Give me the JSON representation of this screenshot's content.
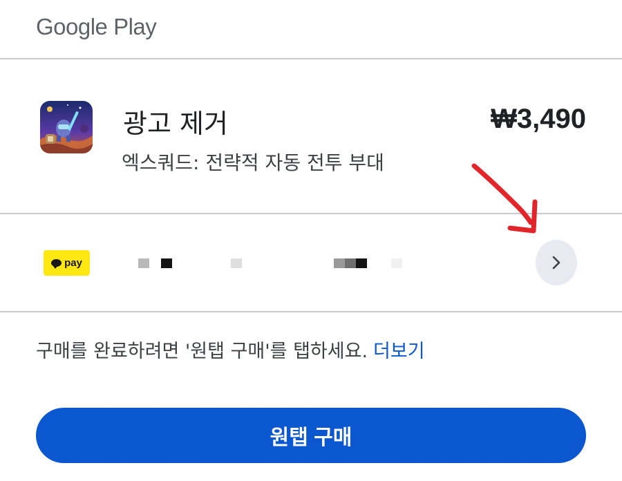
{
  "header": {
    "title": "Google Play"
  },
  "item": {
    "title": "광고 제거",
    "subtitle": "엑스쿼드: 전략적 자동 전투 부대",
    "price": "₩3,490",
    "icon": "app-game-icon"
  },
  "payment": {
    "method_label": "pay",
    "method_icon": "kakao-pay-icon",
    "brand_color": "#ffe812",
    "details_icon": "chevron-right-icon"
  },
  "notice": {
    "text": "구매를 완료하려면 '원탭 구매'를 탭하세요.",
    "more_link": "더보기"
  },
  "buy_button": {
    "label": "원탭 구매",
    "color": "#0b57d0"
  }
}
